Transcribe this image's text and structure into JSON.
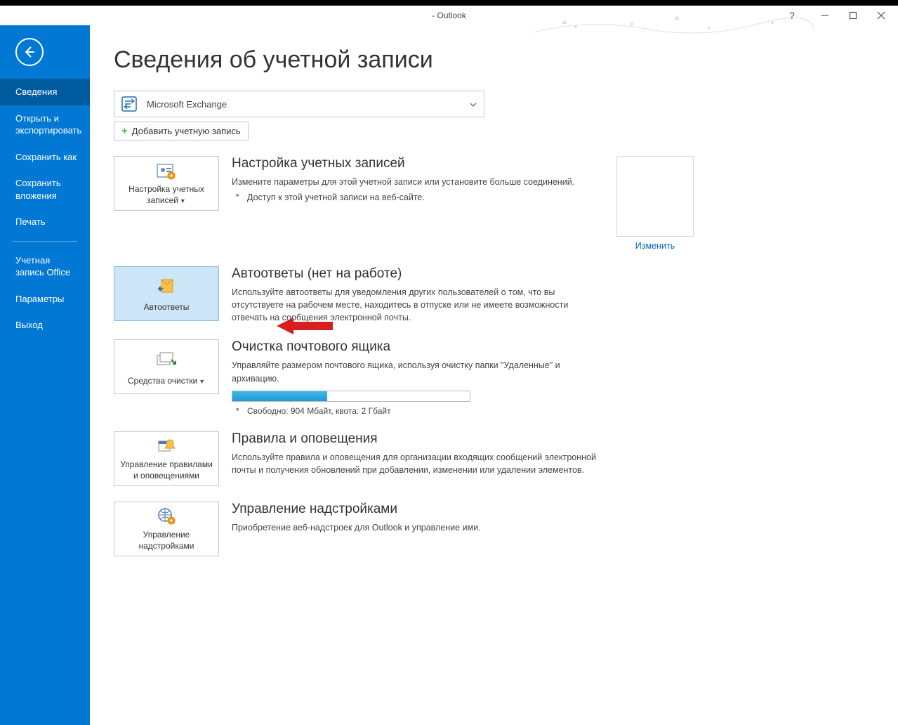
{
  "window": {
    "title_suffix": "- Outlook"
  },
  "sidebar": {
    "items": [
      {
        "label": "Сведения",
        "active": true
      },
      {
        "label": "Открыть и экспортировать",
        "active": false
      },
      {
        "label": "Сохранить как",
        "active": false
      },
      {
        "label": "Сохранить вложения",
        "active": false
      },
      {
        "label": "Печать",
        "active": false
      }
    ],
    "items_after_sep": [
      {
        "label": "Учетная запись Office"
      },
      {
        "label": "Параметры"
      },
      {
        "label": "Выход"
      }
    ]
  },
  "page": {
    "title": "Сведения об учетной записи",
    "account_select_label": "Microsoft Exchange",
    "add_account_label": "Добавить учетную запись"
  },
  "sections": {
    "account": {
      "button_label": "Настройка учетных записей",
      "heading": "Настройка учетных записей",
      "desc": "Измените параметры для этой учетной записи или установите больше соединений.",
      "bullet": "Доступ к этой учетной записи на веб-сайте.",
      "change_link": "Изменить"
    },
    "autoreply": {
      "button_label": "Автоответы",
      "heading": "Автоответы (нет на работе)",
      "desc": "Используйте автоответы для уведомления других пользователей о том, что вы отсутствуете на рабочем месте, находитесь в отпуске или не имеете возможности отвечать на сообщения электронной почты."
    },
    "cleanup": {
      "button_label": "Средства очистки",
      "heading": "Очистка почтового ящика",
      "desc": "Управляйте размером почтового ящика, используя очистку папки \"Удаленные\" и архивацию.",
      "quota_text": "Свободно: 904 Мбайт, квота: 2 Гбайт"
    },
    "rules": {
      "button_label": "Управление правилами и оповещениями",
      "heading": "Правила и оповещения",
      "desc": "Используйте правила и оповещения для организации входящих сообщений электронной почты и получения обновлений при добавлении, изменении или удалении элементов."
    },
    "addins": {
      "button_label": "Управление надстройками",
      "heading": "Управление надстройками",
      "desc": "Приобретение веб-надстроек для Outlook и управление ими."
    }
  }
}
